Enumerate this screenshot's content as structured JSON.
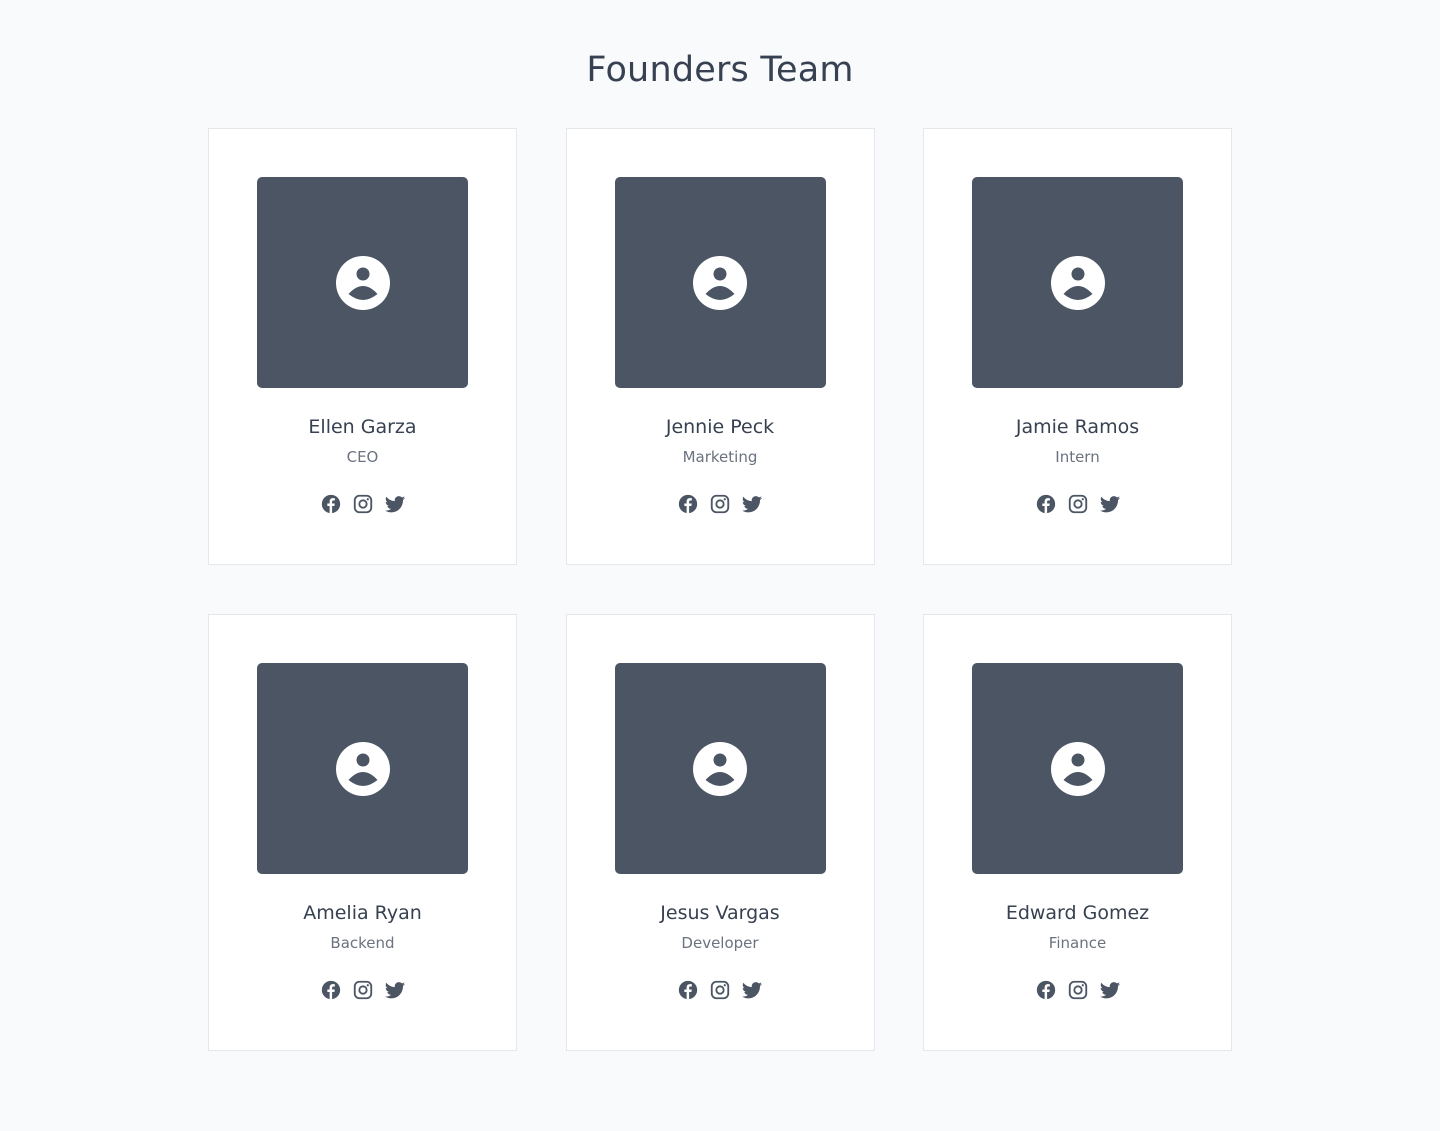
{
  "page": {
    "title": "Founders Team"
  },
  "colors": {
    "background": "#f8fafc",
    "card": "#ffffff",
    "card_border": "#e5e7eb",
    "photo_placeholder": "#4b5563",
    "heading": "#374151",
    "subtext": "#6b7280",
    "icon": "#4b5563"
  },
  "team": [
    {
      "name": "Ellen Garza",
      "role": "CEO",
      "photo_icon": "user-circle-icon",
      "socials": [
        "facebook-icon",
        "instagram-icon",
        "twitter-icon"
      ]
    },
    {
      "name": "Jennie Peck",
      "role": "Marketing",
      "photo_icon": "user-circle-icon",
      "socials": [
        "facebook-icon",
        "instagram-icon",
        "twitter-icon"
      ]
    },
    {
      "name": "Jamie Ramos",
      "role": "Intern",
      "photo_icon": "user-circle-icon",
      "socials": [
        "facebook-icon",
        "instagram-icon",
        "twitter-icon"
      ]
    },
    {
      "name": "Amelia Ryan",
      "role": "Backend",
      "photo_icon": "user-circle-icon",
      "socials": [
        "facebook-icon",
        "instagram-icon",
        "twitter-icon"
      ]
    },
    {
      "name": "Jesus Vargas",
      "role": "Developer",
      "photo_icon": "user-circle-icon",
      "socials": [
        "facebook-icon",
        "instagram-icon",
        "twitter-icon"
      ]
    },
    {
      "name": "Edward Gomez",
      "role": "Finance",
      "photo_icon": "user-circle-icon",
      "socials": [
        "facebook-icon",
        "instagram-icon",
        "twitter-icon"
      ]
    }
  ]
}
